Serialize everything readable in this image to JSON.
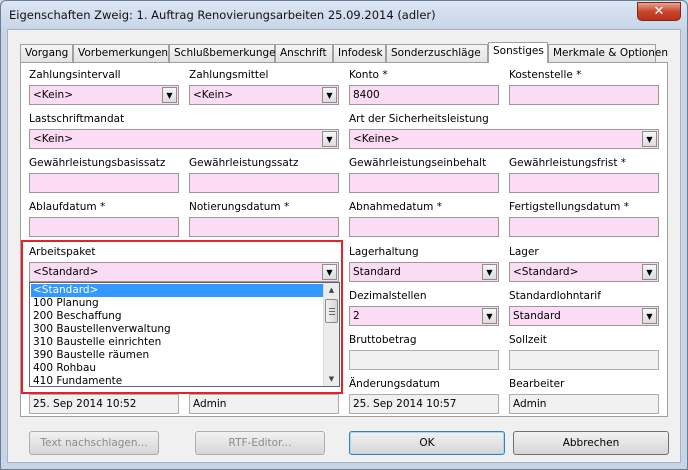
{
  "window": {
    "title": "Eigenschaften Zweig: 1. Auftrag Renovierungsarbeiten 25.09.2014 (adler)",
    "close_symbol": "✕"
  },
  "tabs": [
    "Vorgang",
    "Vorbemerkungen",
    "Schlußbemerkungen",
    "Anschrift",
    "Infodesk",
    "Sonderzuschläge",
    "Sonstiges",
    "Merkmale & Optionen"
  ],
  "active_tab": "Sonstiges",
  "fields": {
    "zahlungsintervall": {
      "label": "Zahlungsintervall",
      "value": "<Kein>"
    },
    "zahlungsmittel": {
      "label": "Zahlungsmittel",
      "value": "<Kein>"
    },
    "konto": {
      "label": "Konto *",
      "value": "8400"
    },
    "kostenstelle": {
      "label": "Kostenstelle *",
      "value": ""
    },
    "lastschriftmandat": {
      "label": "Lastschriftmandat",
      "value": "<Kein>"
    },
    "sicherheitsleistung": {
      "label": "Art der Sicherheitsleistung",
      "value": "<Keine>"
    },
    "gw_basissatz": {
      "label": "Gewährleistungsbasissatz",
      "value": ""
    },
    "gw_satz": {
      "label": "Gewährleistungssatz",
      "value": ""
    },
    "gw_einbehalt": {
      "label": "Gewährleistungseinbehalt",
      "value": ""
    },
    "gw_frist": {
      "label": "Gewährleistungsfrist *",
      "value": ""
    },
    "ablaufdatum": {
      "label": "Ablaufdatum *",
      "value": ""
    },
    "notierungsdatum": {
      "label": "Notierungsdatum *",
      "value": ""
    },
    "abnahmedatum": {
      "label": "Abnahmedatum *",
      "value": ""
    },
    "fertigstellungsdatum": {
      "label": "Fertigstellungsdatum *",
      "value": ""
    },
    "arbeitspaket": {
      "label": "Arbeitspaket",
      "value": "<Standard>"
    },
    "lagerhaltung": {
      "label": "Lagerhaltung",
      "value": "Standard"
    },
    "lager": {
      "label": "Lager",
      "value": "<Standard>"
    },
    "dezimalstellen": {
      "label": "Dezimalstellen",
      "value": "2"
    },
    "standardlohntarif": {
      "label": "Standardlohntarif",
      "value": "Standard"
    },
    "bruttobetrag": {
      "label": "Bruttobetrag",
      "value": ""
    },
    "sollzeit": {
      "label": "Sollzeit",
      "value": ""
    },
    "erstelldatum": {
      "value": "25. Sep 2014 10:52"
    },
    "ersteller": {
      "value": "Admin"
    },
    "aenderungsdatum": {
      "label": "Änderungsdatum",
      "value": "25. Sep 2014 10:57"
    },
    "bearbeiter": {
      "label": "Bearbeiter",
      "value": "Admin"
    }
  },
  "dropdown_items": [
    "<Standard>",
    "100 Planung",
    "200 Beschaffung",
    "300 Baustellenverwaltung",
    "310 Baustelle einrichten",
    "390 Baustelle räumen",
    "400 Rohbau",
    "410 Fundamente"
  ],
  "dropdown_arrow": "▼",
  "buttons": {
    "text_nachschlagen": "Text nachschlagen...",
    "rtf_editor": "RTF-Editor...",
    "ok": "OK",
    "abbrechen": "Abbrechen"
  }
}
